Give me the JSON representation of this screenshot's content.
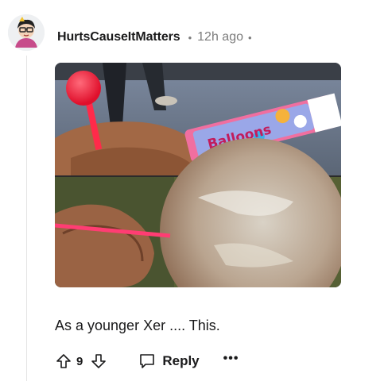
{
  "comment": {
    "author": "HurtsCauseItMatters",
    "separator": "•",
    "timestamp": "12h ago",
    "text": "As a younger Xer .... This."
  },
  "media": {
    "package_text": "Balloons",
    "description_icon": "balloon-photo"
  },
  "actions": {
    "vote_count": "9",
    "reply_label": "Reply",
    "more_label": "•••",
    "upvote_icon": "upvote-arrow-icon",
    "downvote_icon": "downvote-arrow-icon",
    "reply_icon": "speech-bubble-icon"
  }
}
